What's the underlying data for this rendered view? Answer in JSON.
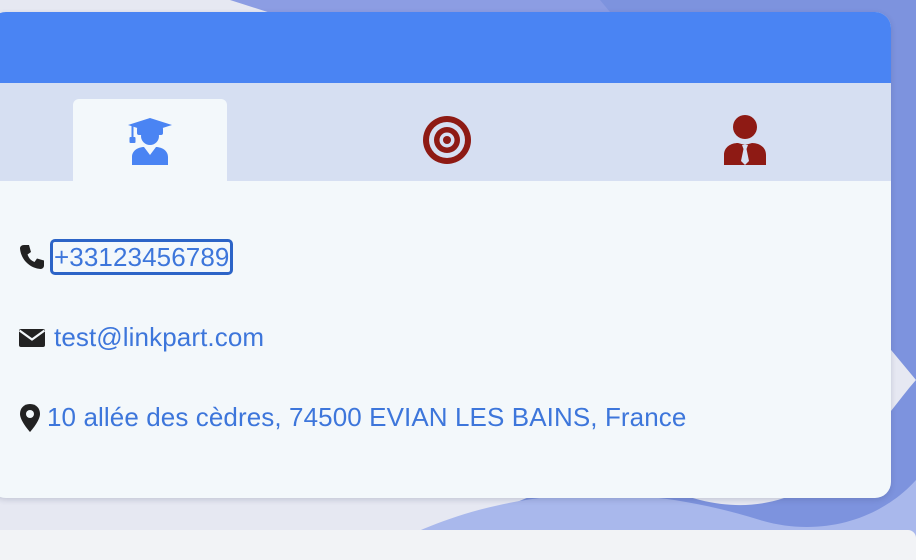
{
  "colors": {
    "header": "#4a84f3",
    "tabbar": "#d6dff2",
    "card": "#f3f8fb",
    "link": "#3d76db",
    "icon_dark": "#222222",
    "icon_active": "#4a84f3",
    "icon_inactive": "#8e1a14"
  },
  "tabs": [
    {
      "icon": "graduate-icon",
      "active": true
    },
    {
      "icon": "target-icon",
      "active": false
    },
    {
      "icon": "user-tie-icon",
      "active": false
    }
  ],
  "contact": {
    "phone": {
      "icon": "phone-icon",
      "value": "+33123456789"
    },
    "email": {
      "icon": "envelope-icon",
      "value": "test@linkpart.com"
    },
    "address": {
      "icon": "map-pin-icon",
      "value": "10 allée des cèdres, 74500 EVIAN LES BAINS, France"
    }
  }
}
